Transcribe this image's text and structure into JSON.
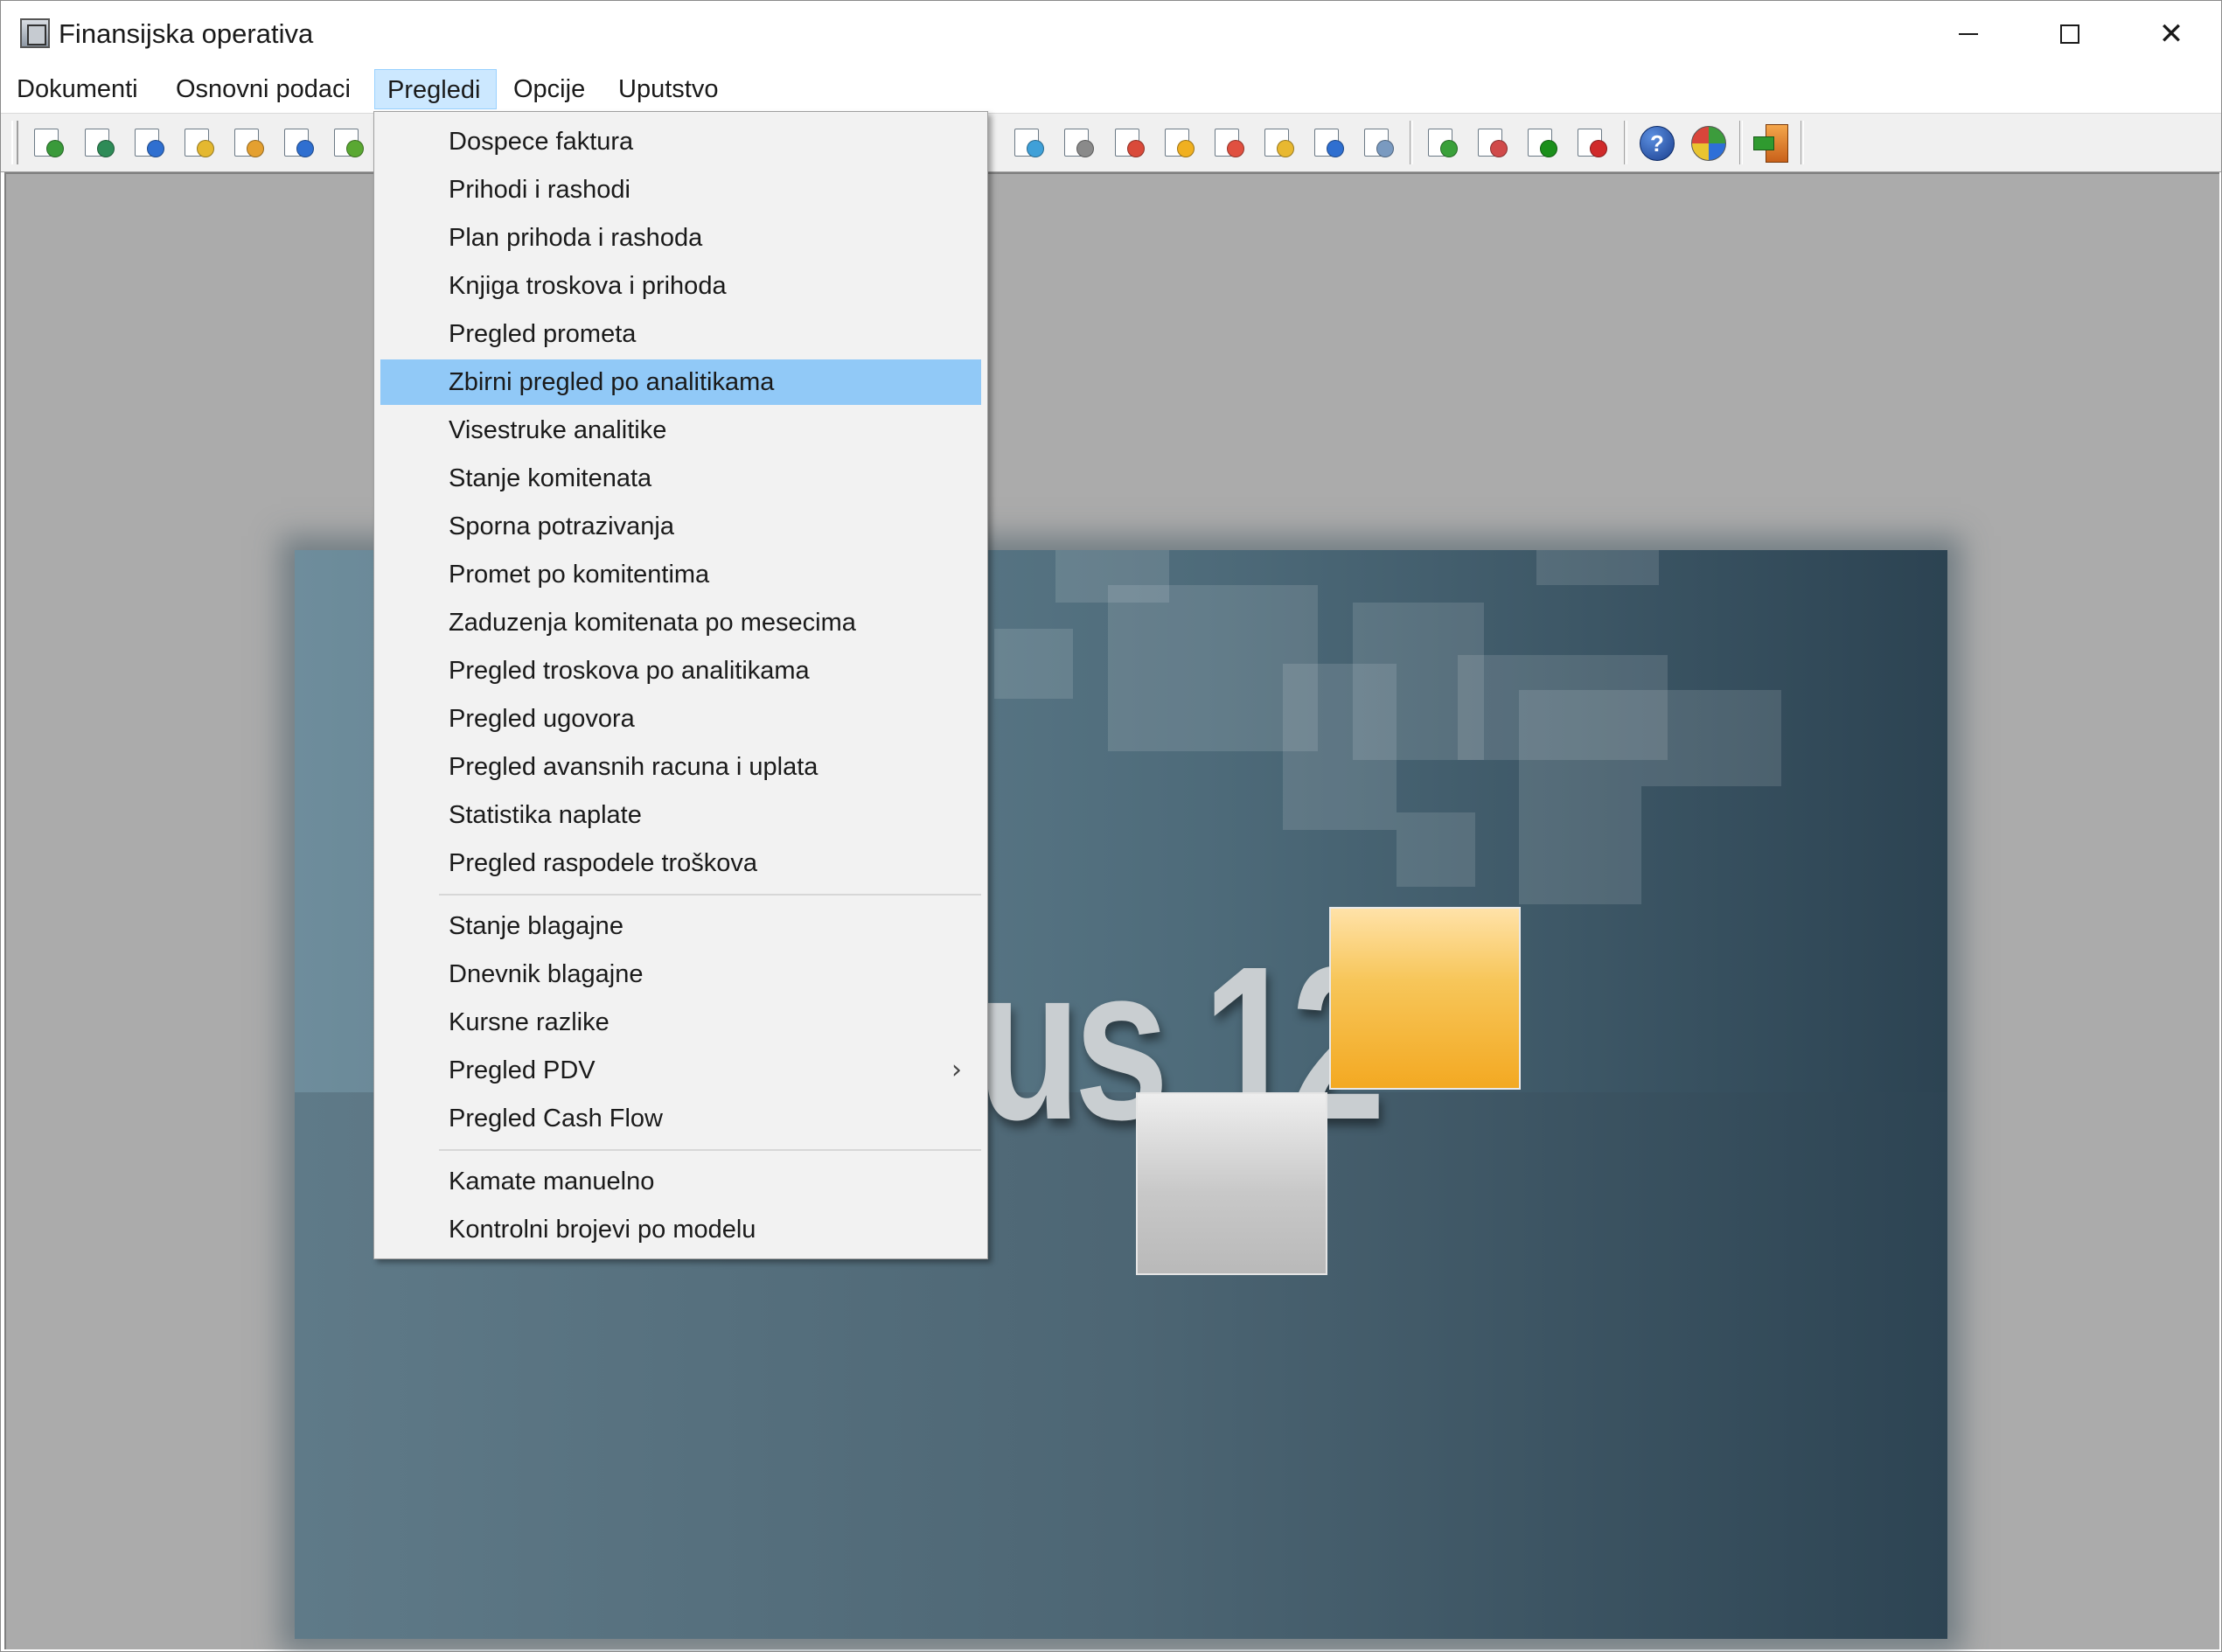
{
  "window": {
    "title": "Finansijska operativa",
    "controls": {
      "minimize": "minimize",
      "maximize": "maximize",
      "close": "✕"
    }
  },
  "menubar": {
    "items": [
      "Dokumenti",
      "Osnovni podaci",
      "Pregledi",
      "Opcije",
      "Uputstvo"
    ],
    "active": "Pregledi"
  },
  "dropdown": {
    "group1": [
      "Dospece faktura",
      "Prihodi i rashodi",
      "Plan prihoda i rashoda",
      "Knjiga troskova i prihoda",
      "Pregled prometa",
      "Zbirni pregled po analitikama",
      "Visestruke analitike",
      "Stanje komitenata",
      "Sporna potrazivanja",
      "Promet po komitentima",
      "Zaduzenja komitenata po mesecima",
      "Pregled troskova po analitikama",
      "Pregled ugovora",
      "Pregled avansnih racuna i uplata",
      "Statistika naplate",
      "Pregled raspodele troškova"
    ],
    "group2": [
      "Stanje blagajne",
      "Dnevnik blagajne",
      "Kursne razlike",
      "Pregled PDV",
      "Pregled Cash Flow"
    ],
    "group3": [
      "Kamate manuelno",
      "Kontrolni brojevi po modelu"
    ],
    "highlighted": "Zbirni pregled po analitikama",
    "submenu_arrow": "›"
  },
  "splash": {
    "text": "us 12"
  },
  "toolbar": {
    "icons": [
      "recycle-icon",
      "document-green-icon",
      "document-blue-icon",
      "edit-document-icon",
      "edit-document-2-icon",
      "users-add-icon",
      "users-export-icon"
    ],
    "icons_right": [
      "report-search-icon",
      "report-print-icon",
      "report-folder-icon",
      "report-warning-icon",
      "report-export-icon",
      "report-shield-icon",
      "report-info-icon",
      "report-calendar-icon",
      "stats-green-icon",
      "stats-blue-icon",
      "stats-green-dark-icon",
      "stats-red-icon"
    ],
    "help_glyph": "?"
  },
  "colors": {
    "menu_highlight": "#91c9f7",
    "active_menu": "#cce8ff",
    "splash_orange": "#f3a922",
    "client_bg": "#ababab"
  }
}
